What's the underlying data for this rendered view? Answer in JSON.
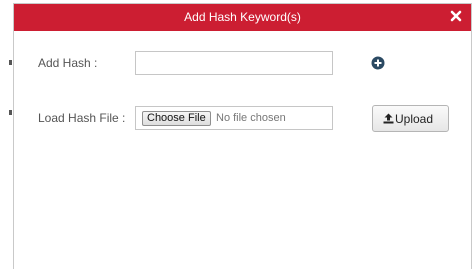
{
  "dialog": {
    "title": "Add Hash Keyword(s)",
    "close_symbol": "×"
  },
  "add_hash": {
    "label": "Add Hash :",
    "value": "",
    "add_icon": "plus-circle-icon"
  },
  "load_hash_file": {
    "label": "Load Hash File :",
    "choose_button_label": "Choose File",
    "file_status": "No file chosen",
    "upload_button_label": "Upload",
    "upload_icon": "upload-icon"
  },
  "colors": {
    "titlebar": "#cc1e32",
    "add_icon": "#2b4a63"
  }
}
